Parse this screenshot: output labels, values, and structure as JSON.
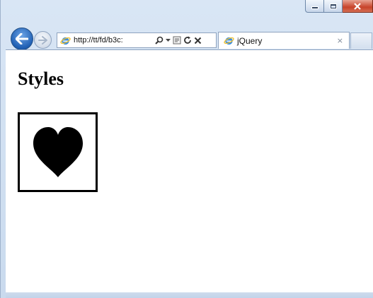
{
  "browser": {
    "address_url": "http://tt/fd/b3c:",
    "tab_title": "jQuery",
    "tab_close_glyph": "×",
    "icons": {
      "back": "back-arrow-icon",
      "forward": "forward-arrow-icon",
      "site": "ie-logo-icon",
      "search": "search-icon",
      "dropdown": "chevron-down-icon",
      "compat": "compatibility-view-icon",
      "refresh": "refresh-icon",
      "stop": "stop-icon"
    },
    "colors": {
      "frame": "#c9daee",
      "close_button": "#c7432a",
      "back_button": "#1f5fb3"
    }
  },
  "page": {
    "heading": "Styles",
    "image_icon": "heart-icon"
  }
}
